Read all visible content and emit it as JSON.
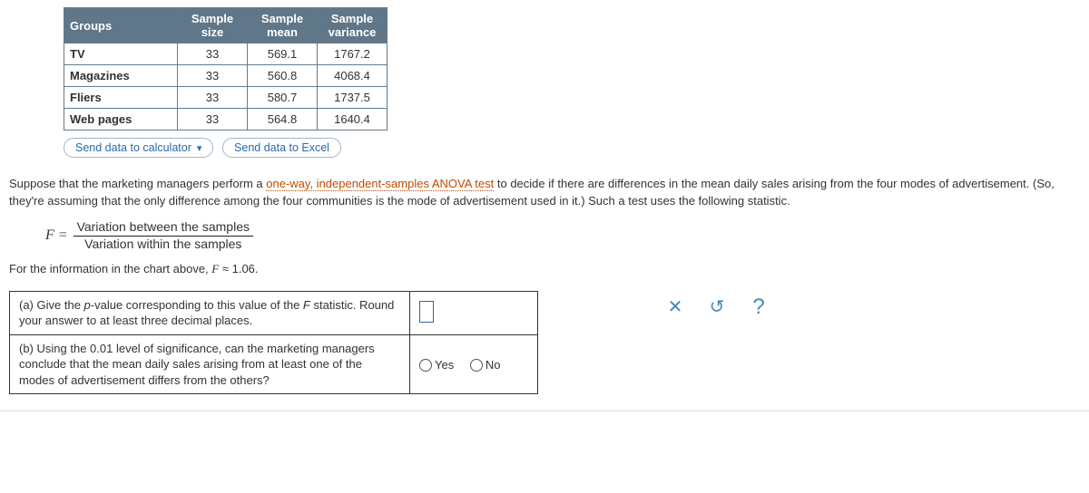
{
  "table": {
    "headers": {
      "groups": "Groups",
      "size": "Sample size",
      "mean": "Sample mean",
      "variance": "Sample variance"
    },
    "rows": [
      {
        "label": "TV",
        "size": "33",
        "mean": "569.1",
        "variance": "1767.2"
      },
      {
        "label": "Magazines",
        "size": "33",
        "mean": "560.8",
        "variance": "4068.4"
      },
      {
        "label": "Fliers",
        "size": "33",
        "mean": "580.7",
        "variance": "1737.5"
      },
      {
        "label": "Web pages",
        "size": "33",
        "mean": "564.8",
        "variance": "1640.4"
      }
    ]
  },
  "buttons": {
    "send_calc": "Send data to calculator",
    "send_excel": "Send data to Excel"
  },
  "paragraph": {
    "pre": "Suppose that the marketing managers perform a ",
    "link": "one-way, independent-samples ANOVA test",
    "post": " to decide if there are differences in the mean daily sales arising from the four modes of advertisement. (So, they're assuming that the only difference among the four communities is the mode of advertisement used in it.) Such a test uses the following statistic."
  },
  "formula": {
    "lhs": "F =",
    "top": "Variation between the samples",
    "bot": "Variation within the samples"
  },
  "fline": {
    "pre": "For the information in the chart above, ",
    "F": "F",
    "approx": " ≈ 1.06."
  },
  "qa": {
    "a_label": "(a)",
    "a_text1": "Give the ",
    "a_p": "p",
    "a_text2": "-value corresponding to this value of the ",
    "a_F": "F",
    "a_text3": " statistic. Round your answer to at least three decimal places.",
    "b_label": "(b)",
    "b_text": "Using the 0.01 level of significance, can the marketing managers conclude that the mean daily sales arising from at least one of the modes of advertisement differs from the others?",
    "yes": "Yes",
    "no": "No"
  },
  "chart_data": {
    "type": "table",
    "columns": [
      "Groups",
      "Sample size",
      "Sample mean",
      "Sample variance"
    ],
    "rows": [
      [
        "TV",
        33,
        569.1,
        1767.2
      ],
      [
        "Magazines",
        33,
        560.8,
        4068.4
      ],
      [
        "Fliers",
        33,
        580.7,
        1737.5
      ],
      [
        "Web pages",
        33,
        564.8,
        1640.4
      ]
    ],
    "F_statistic": 1.06
  }
}
